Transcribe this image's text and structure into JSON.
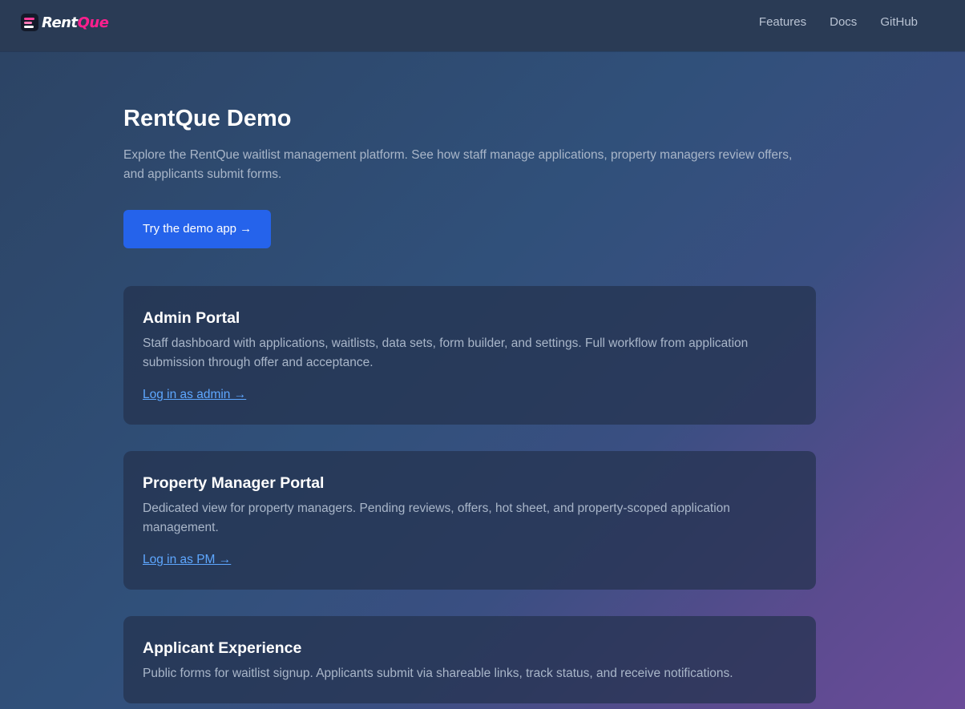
{
  "brand": {
    "name_part1": "Rent",
    "name_part2": "Que",
    "accent_color": "#ff1f8e",
    "icon": "list-icon"
  },
  "nav": {
    "links": [
      "Features",
      "Docs",
      "GitHub"
    ]
  },
  "hero": {
    "title": "RentQue Demo",
    "description": "Explore the RentQue waitlist management platform. See how staff manage applications, property managers review offers, and applicants submit forms.",
    "cta_label": "Try the demo app →",
    "cta_color": "#2563eb"
  },
  "cards": [
    {
      "title": "Admin Portal",
      "description": "Staff dashboard with applications, waitlists, data sets, form builder, and settings. Full workflow from application submission through offer and acceptance.",
      "link_label": "Log in as admin →"
    },
    {
      "title": "Property Manager Portal",
      "description": "Dedicated view for property managers. Pending reviews, offers, hot sheet, and property-scoped application management.",
      "link_label": "Log in as PM →"
    },
    {
      "title": "Applicant Experience",
      "description": "Public forms for waitlist signup. Applicants submit via shareable links, track status, and receive notifications."
    }
  ]
}
